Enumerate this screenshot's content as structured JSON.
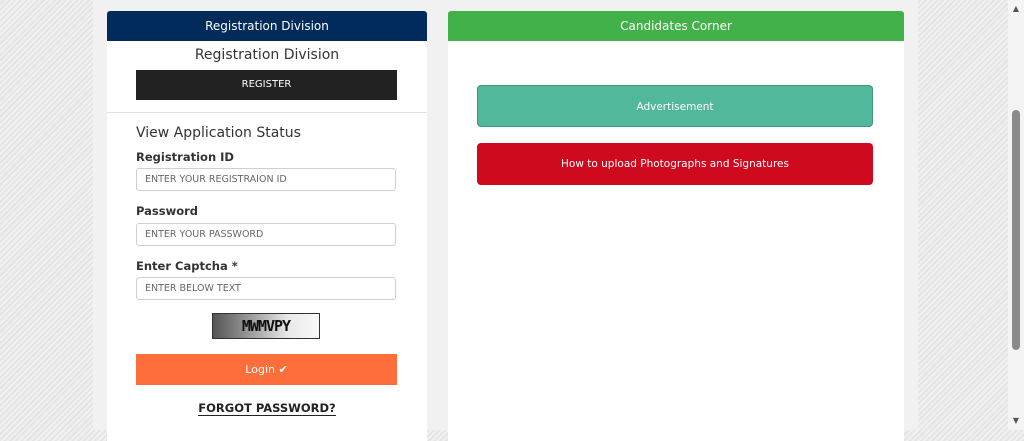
{
  "left_panel": {
    "header": "Registration Division",
    "title": "Registration Division",
    "register_label": "REGISTER",
    "status_title": "View Application Status",
    "fields": {
      "registration_id": {
        "label": "Registration ID",
        "placeholder": "ENTER YOUR REGISTRAION ID"
      },
      "password": {
        "label": "Password",
        "placeholder": "ENTER YOUR PASSWORD"
      },
      "captcha": {
        "label": "Enter Captcha *",
        "placeholder": "ENTER BELOW TEXT"
      }
    },
    "captcha_text": "MWMVPY",
    "login_label": "Login ✔",
    "forgot_label": "FORGOT PASSWORD?"
  },
  "right_panel": {
    "header": "Candidates Corner",
    "advertisement_label": "Advertisement",
    "upload_label": "How to upload Photographs and Signatures"
  },
  "colors": {
    "left_header": "#012b5a",
    "right_header": "#43b149",
    "register_btn": "#222222",
    "login_btn": "#fd6e3b",
    "advertisement_btn": "#52b89b",
    "upload_btn": "#cf0a1f"
  },
  "icons": {
    "login": "check-icon",
    "scroll_up": "chevron-up-icon",
    "scroll_down": "chevron-down-icon"
  }
}
